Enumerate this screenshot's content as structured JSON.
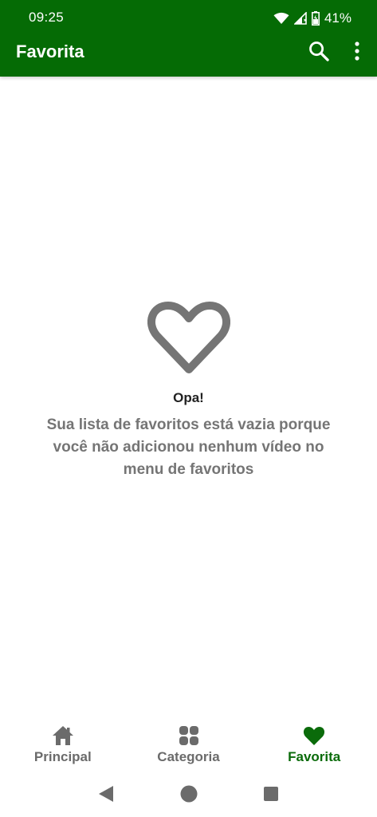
{
  "status_bar": {
    "time": "09:25",
    "battery": "41%",
    "icons": [
      "wifi-icon",
      "cell-signal-icon",
      "battery-icon"
    ]
  },
  "toolbar": {
    "title": "Favorita",
    "icons": [
      "search-icon",
      "more-vert-icon"
    ]
  },
  "empty_state": {
    "icon": "heart-outline-icon",
    "title": "Opa!",
    "message": "Sua lista de favoritos está vazia porque você não adicionou nenhum vídeo no menu de favoritos"
  },
  "bottom_nav": {
    "items": [
      {
        "label": "Principal",
        "icon": "home-icon",
        "active": false
      },
      {
        "label": "Categoria",
        "icon": "category-grid-icon",
        "active": false
      },
      {
        "label": "Favorita",
        "icon": "heart-icon",
        "active": true
      }
    ]
  },
  "system_nav": {
    "icons": [
      "back-icon",
      "home-circle-icon",
      "recents-icon"
    ]
  },
  "colors": {
    "primary": "#056b05",
    "active_nav": "#0a6b0a",
    "inactive_nav": "#6b6b6b",
    "empty_icon": "#757575"
  }
}
